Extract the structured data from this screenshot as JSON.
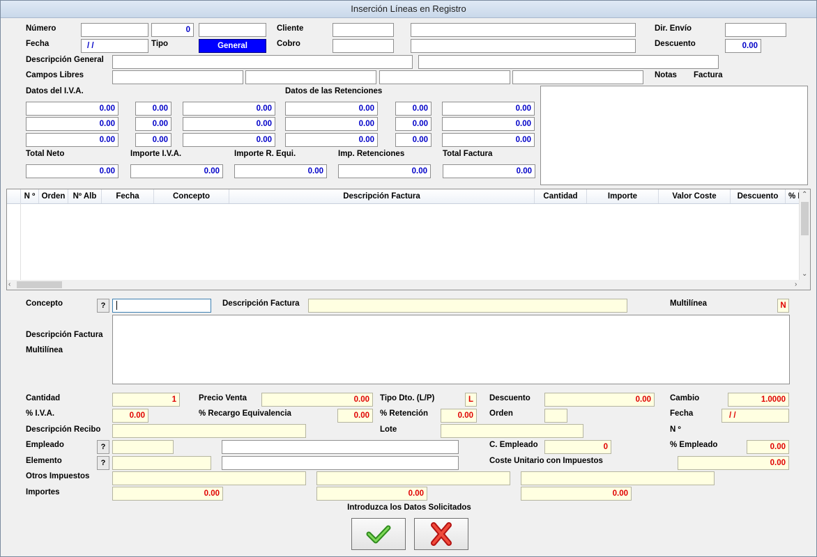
{
  "window": {
    "title": "Inserción Líneas en Registro"
  },
  "header": {
    "numero_label": "Número",
    "numero_value": "0",
    "fecha_label": "Fecha",
    "fecha_value": " / /",
    "tipo_label": "Tipo",
    "tipo_value": "General",
    "cliente_label": "Cliente",
    "cobro_label": "Cobro",
    "dir_envio_label": "Dir. Envío",
    "descuento_label": "Descuento",
    "descuento_value": "0.00",
    "descripcion_general_label": "Descripción General",
    "campos_libres_label": "Campos Libres",
    "notas_label": "Notas",
    "factura_label": "Factura"
  },
  "iva": {
    "title": "Datos del I.V.A.",
    "rows": [
      [
        "0.00",
        "0.00",
        "0.00"
      ],
      [
        "0.00",
        "0.00",
        "0.00"
      ],
      [
        "0.00",
        "0.00",
        "0.00"
      ]
    ]
  },
  "retenciones": {
    "title": "Datos de las Retenciones",
    "rows": [
      [
        "0.00",
        "0.00",
        "0.00"
      ],
      [
        "0.00",
        "0.00",
        "0.00"
      ],
      [
        "0.00",
        "0.00",
        "0.00"
      ]
    ]
  },
  "totals": {
    "total_neto_label": "Total Neto",
    "total_neto": "0.00",
    "importe_iva_label": "Importe I.V.A.",
    "importe_iva": "0.00",
    "importe_requi_label": "Importe R. Equi.",
    "importe_requi": "0.00",
    "imp_retenciones_label": "Imp. Retenciones",
    "imp_retenciones": "0.00",
    "total_factura_label": "Total Factura",
    "total_factura": "0.00"
  },
  "grid": {
    "columns": [
      "N º",
      "Orden",
      "Nº Alb",
      "Fecha",
      "Concepto",
      "Descripción Factura",
      "Cantidad",
      "Importe",
      "Valor Coste",
      "Descuento",
      "% I"
    ]
  },
  "line": {
    "concepto_label": "Concepto",
    "help_label": "?",
    "descripcion_factura_label": "Descripción Factura",
    "multilinea_label": "Multilínea",
    "multilinea_value": "N",
    "desc_multilinea_label_1": "Descripción Factura",
    "desc_multilinea_label_2": "Multilínea",
    "cantidad_label": "Cantidad",
    "cantidad_value": "1",
    "precio_venta_label": "Precio Venta",
    "precio_venta_value": "0.00",
    "tipo_dto_label": "Tipo Dto. (L/P)",
    "tipo_dto_value": "L",
    "descuento_label": "Descuento",
    "descuento_value": "0.00",
    "cambio_label": "Cambio",
    "cambio_value": "1.0000",
    "iva_label": "% I.V.A.",
    "iva_value": "0.00",
    "recargo_label": "% Recargo Equivalencia",
    "recargo_value": "0.00",
    "retencion_label": "% Retención",
    "retencion_value": "0.00",
    "orden_label": "Orden",
    "fecha_label": "Fecha",
    "fecha_value": " / /",
    "descripcion_recibo_label": "Descripción Recibo",
    "lote_label": "Lote",
    "n_label": "N º",
    "empleado_label": "Empleado",
    "c_empleado_label": "C. Empleado",
    "c_empleado_value": "0",
    "pct_empleado_label": "%  Empleado",
    "pct_empleado_value": "0.00",
    "elemento_label": "Elemento",
    "coste_unitario_label": "Coste Unitario con Impuestos",
    "coste_unitario_value": "0.00",
    "otros_impuestos_label": "Otros Impuestos",
    "importes_label": "Importes",
    "importes_values": [
      "0.00",
      "0.00",
      "0.00"
    ]
  },
  "status": {
    "message": "Introduzca los Datos Solicitados"
  },
  "colors": {
    "accent": "#0000ff",
    "value_blue": "#0000c8",
    "value_red": "#e00000",
    "field_yellow": "#ffffe1"
  }
}
